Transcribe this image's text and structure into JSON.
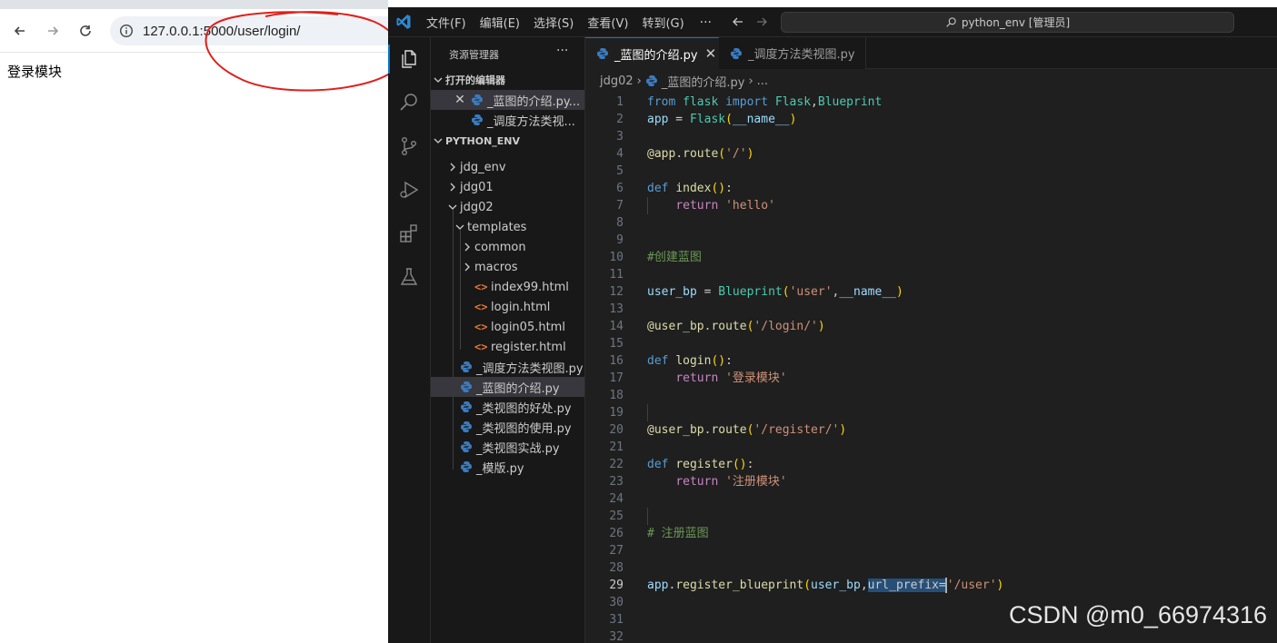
{
  "browser": {
    "url": "127.0.0.1:5000/user/login/",
    "page_text": "登录模块"
  },
  "vscode": {
    "menu": [
      "文件(F)",
      "编辑(E)",
      "选择(S)",
      "查看(V)",
      "转到(G)",
      "···"
    ],
    "search_text": "python_env [管理员]",
    "sidebar": {
      "title": "资源管理器",
      "more": "···",
      "open_editors_label": "打开的编辑器",
      "open_editors": [
        {
          "label": "_蓝图的介绍.py...",
          "icon": "python-icon",
          "active": true
        },
        {
          "label": "_调度方法类视...",
          "icon": "python-icon",
          "active": false
        }
      ],
      "workspace_label": "PYTHON_ENV",
      "tree": [
        {
          "label": "jdg_env",
          "type": "folder",
          "level": 0,
          "expanded": false
        },
        {
          "label": "jdg01",
          "type": "folder",
          "level": 0,
          "expanded": false
        },
        {
          "label": "jdg02",
          "type": "folder",
          "level": 0,
          "expanded": true
        },
        {
          "label": "templates",
          "type": "folder",
          "level": 1,
          "expanded": true
        },
        {
          "label": "common",
          "type": "folder",
          "level": 2,
          "expanded": false
        },
        {
          "label": "macros",
          "type": "folder",
          "level": 2,
          "expanded": false
        },
        {
          "label": "index99.html",
          "type": "html",
          "level": 2
        },
        {
          "label": "login.html",
          "type": "html",
          "level": 2
        },
        {
          "label": "login05.html",
          "type": "html",
          "level": 2
        },
        {
          "label": "register.html",
          "type": "html",
          "level": 2
        },
        {
          "label": "_调度方法类视图.py",
          "type": "python",
          "level": 1
        },
        {
          "label": "_蓝图的介绍.py",
          "type": "python",
          "level": 1,
          "selected": true
        },
        {
          "label": "_类视图的好处.py",
          "type": "python",
          "level": 1
        },
        {
          "label": "_类视图的使用.py",
          "type": "python",
          "level": 1
        },
        {
          "label": "_类视图实战.py",
          "type": "python",
          "level": 1
        },
        {
          "label": "_模版.py",
          "type": "python",
          "level": 1
        }
      ]
    },
    "tabs": [
      {
        "label": "_蓝图的介绍.py",
        "active": true,
        "close": "✕"
      },
      {
        "label": "_调度方法类视图.py",
        "active": false
      }
    ],
    "breadcrumb": {
      "folder": "jdg02",
      "file": "_蓝图的介绍.py",
      "more": "..."
    },
    "current_line": 29,
    "code_lines": [
      {
        "n": "1",
        "tokens": [
          [
            "kw",
            "from"
          ],
          [
            "t",
            " "
          ],
          [
            "cls",
            "flask"
          ],
          [
            "t",
            " "
          ],
          [
            "kw",
            "import"
          ],
          [
            "t",
            " "
          ],
          [
            "cls",
            "Flask"
          ],
          [
            "t",
            ","
          ],
          [
            "cls",
            "Blueprint"
          ]
        ]
      },
      {
        "n": "2",
        "tokens": [
          [
            "var",
            "app"
          ],
          [
            "t",
            " = "
          ],
          [
            "cls",
            "Flask"
          ],
          [
            "paren",
            "("
          ],
          [
            "var",
            "__name__"
          ],
          [
            "paren",
            ")"
          ]
        ]
      },
      {
        "n": "3",
        "tokens": []
      },
      {
        "n": "4",
        "tokens": [
          [
            "fn",
            "@app"
          ],
          [
            "t",
            "."
          ],
          [
            "fn",
            "route"
          ],
          [
            "paren",
            "("
          ],
          [
            "str",
            "'/'"
          ],
          [
            "paren",
            ")"
          ]
        ]
      },
      {
        "n": "5",
        "tokens": []
      },
      {
        "n": "6",
        "tokens": [
          [
            "kw",
            "def"
          ],
          [
            "t",
            " "
          ],
          [
            "fn",
            "index"
          ],
          [
            "paren",
            "()"
          ],
          [
            "t",
            ":"
          ]
        ]
      },
      {
        "n": "7",
        "tokens": [
          [
            "t",
            "    "
          ],
          [
            "ctl",
            "return"
          ],
          [
            "t",
            " "
          ],
          [
            "str",
            "'hello'"
          ]
        ]
      },
      {
        "n": "8",
        "tokens": []
      },
      {
        "n": "9",
        "tokens": []
      },
      {
        "n": "10",
        "tokens": [
          [
            "cmt",
            "#创建蓝图"
          ]
        ]
      },
      {
        "n": "11",
        "tokens": []
      },
      {
        "n": "12",
        "tokens": [
          [
            "var",
            "user_bp"
          ],
          [
            "t",
            " = "
          ],
          [
            "cls",
            "Blueprint"
          ],
          [
            "paren",
            "("
          ],
          [
            "str",
            "'user'"
          ],
          [
            "t",
            ","
          ],
          [
            "var",
            "__name__"
          ],
          [
            "paren",
            ")"
          ]
        ]
      },
      {
        "n": "13",
        "tokens": []
      },
      {
        "n": "14",
        "tokens": [
          [
            "fn",
            "@user_bp"
          ],
          [
            "t",
            "."
          ],
          [
            "fn",
            "route"
          ],
          [
            "paren",
            "("
          ],
          [
            "str",
            "'/login/'"
          ],
          [
            "paren",
            ")"
          ]
        ]
      },
      {
        "n": "15",
        "tokens": []
      },
      {
        "n": "16",
        "tokens": [
          [
            "kw",
            "def"
          ],
          [
            "t",
            " "
          ],
          [
            "fn",
            "login"
          ],
          [
            "paren",
            "()"
          ],
          [
            "t",
            ":"
          ]
        ]
      },
      {
        "n": "17",
        "tokens": [
          [
            "t",
            "    "
          ],
          [
            "ctl",
            "return"
          ],
          [
            "t",
            " "
          ],
          [
            "str",
            "'登录模块'"
          ]
        ]
      },
      {
        "n": "18",
        "tokens": []
      },
      {
        "n": "19",
        "tokens": []
      },
      {
        "n": "20",
        "tokens": [
          [
            "fn",
            "@user_bp"
          ],
          [
            "t",
            "."
          ],
          [
            "fn",
            "route"
          ],
          [
            "paren",
            "("
          ],
          [
            "str",
            "'/register/'"
          ],
          [
            "paren",
            ")"
          ]
        ]
      },
      {
        "n": "21",
        "tokens": []
      },
      {
        "n": "22",
        "tokens": [
          [
            "kw",
            "def"
          ],
          [
            "t",
            " "
          ],
          [
            "fn",
            "register"
          ],
          [
            "paren",
            "()"
          ],
          [
            "t",
            ":"
          ]
        ]
      },
      {
        "n": "23",
        "tokens": [
          [
            "t",
            "    "
          ],
          [
            "ctl",
            "return"
          ],
          [
            "t",
            " "
          ],
          [
            "str",
            "'注册模块'"
          ]
        ]
      },
      {
        "n": "24",
        "tokens": []
      },
      {
        "n": "25",
        "tokens": []
      },
      {
        "n": "26",
        "tokens": [
          [
            "cmt",
            "# 注册蓝图"
          ]
        ]
      },
      {
        "n": "27",
        "tokens": []
      },
      {
        "n": "28",
        "tokens": []
      },
      {
        "n": "29",
        "tokens": [
          [
            "var",
            "app"
          ],
          [
            "t",
            "."
          ],
          [
            "fn",
            "register_blueprint"
          ],
          [
            "paren",
            "("
          ],
          [
            "var",
            "user_bp"
          ],
          [
            "t",
            ","
          ],
          [
            "sel",
            "url_prefix="
          ],
          [
            "cursor",
            ""
          ],
          [
            "str",
            "'/user'"
          ],
          [
            "paren",
            ")"
          ]
        ]
      },
      {
        "n": "30",
        "tokens": []
      },
      {
        "n": "31",
        "tokens": []
      },
      {
        "n": "32",
        "tokens": []
      }
    ]
  },
  "watermark": "CSDN @m0_66974316",
  "colors": {
    "annotation": "#e0201b",
    "accent": "#0078d4",
    "python_icon": "#3b7bbf",
    "html_icon": "#e37933"
  }
}
